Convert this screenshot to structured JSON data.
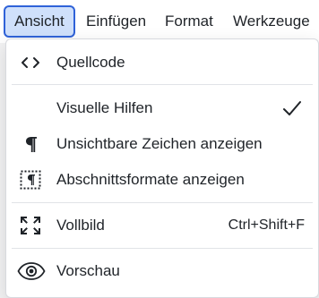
{
  "menubar": {
    "items": [
      {
        "label": "Ansicht",
        "active": true
      },
      {
        "label": "Einfügen",
        "active": false
      },
      {
        "label": "Format",
        "active": false
      },
      {
        "label": "Werkzeuge",
        "active": false
      }
    ]
  },
  "dropdown": {
    "items": [
      {
        "label": "Quellcode",
        "icon": "code-brackets-icon"
      },
      {
        "label": "Visuelle Hilfen",
        "checked": true
      },
      {
        "label": "Unsichtbare Zeichen anzeigen",
        "icon": "pilcrow-icon"
      },
      {
        "label": "Abschnittsformate anzeigen",
        "icon": "show-blocks-icon"
      },
      {
        "label": "Vollbild",
        "icon": "fullscreen-icon",
        "shortcut": "Ctrl+Shift+F"
      },
      {
        "label": "Vorschau",
        "icon": "eye-icon"
      }
    ]
  },
  "colors": {
    "active_menu_bg": "#cfe0fb",
    "active_menu_border": "#2f62d8",
    "text": "#1f2328"
  }
}
